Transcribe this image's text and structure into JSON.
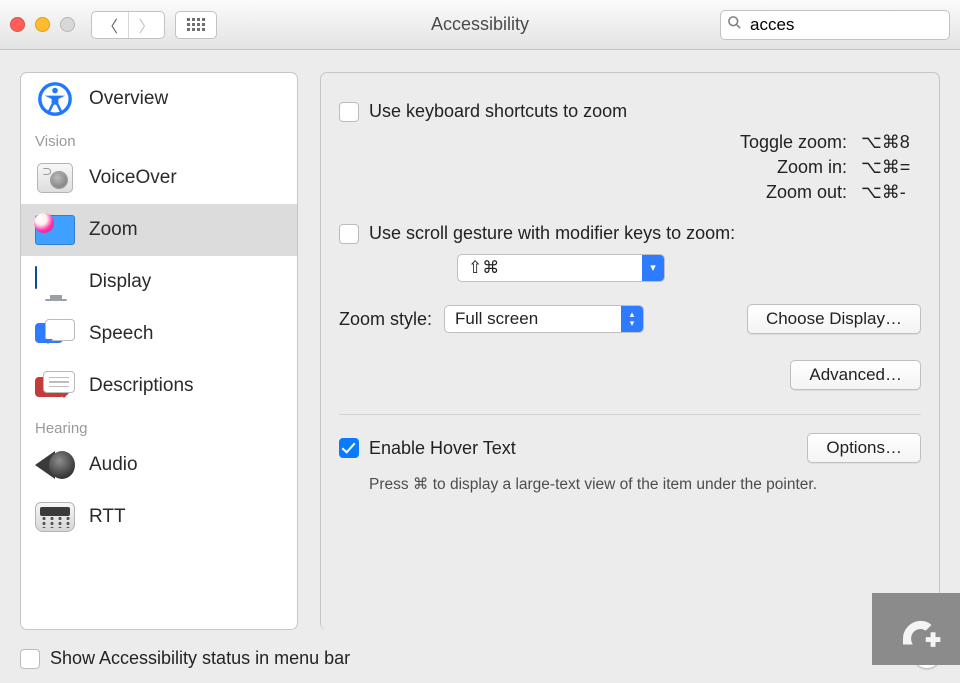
{
  "window": {
    "title": "Accessibility"
  },
  "search": {
    "value": "acces"
  },
  "sidebar": {
    "overview": "Overview",
    "sections": [
      {
        "label": "Vision",
        "items": [
          "VoiceOver",
          "Zoom",
          "Display",
          "Speech",
          "Descriptions"
        ]
      },
      {
        "label": "Hearing",
        "items": [
          "Audio",
          "RTT"
        ]
      }
    ]
  },
  "panel": {
    "kb_shortcuts_label": "Use keyboard shortcuts to zoom",
    "shortcuts": [
      {
        "label": "Toggle zoom:",
        "keys": "⌥⌘8"
      },
      {
        "label": "Zoom in:",
        "keys": "⌥⌘="
      },
      {
        "label": "Zoom out:",
        "keys": "⌥⌘-"
      }
    ],
    "scroll_gesture_label": "Use scroll gesture with modifier keys to zoom:",
    "scroll_modifier": "⇧⌘",
    "zoom_style_label": "Zoom style:",
    "zoom_style_value": "Full screen",
    "choose_display": "Choose Display…",
    "advanced": "Advanced…",
    "hover_text_label": "Enable Hover Text",
    "hover_options": "Options…",
    "hover_hint": "Press ⌘ to display a large-text view of the item under the pointer."
  },
  "footer": {
    "menubar_status": "Show Accessibility status in menu bar"
  }
}
